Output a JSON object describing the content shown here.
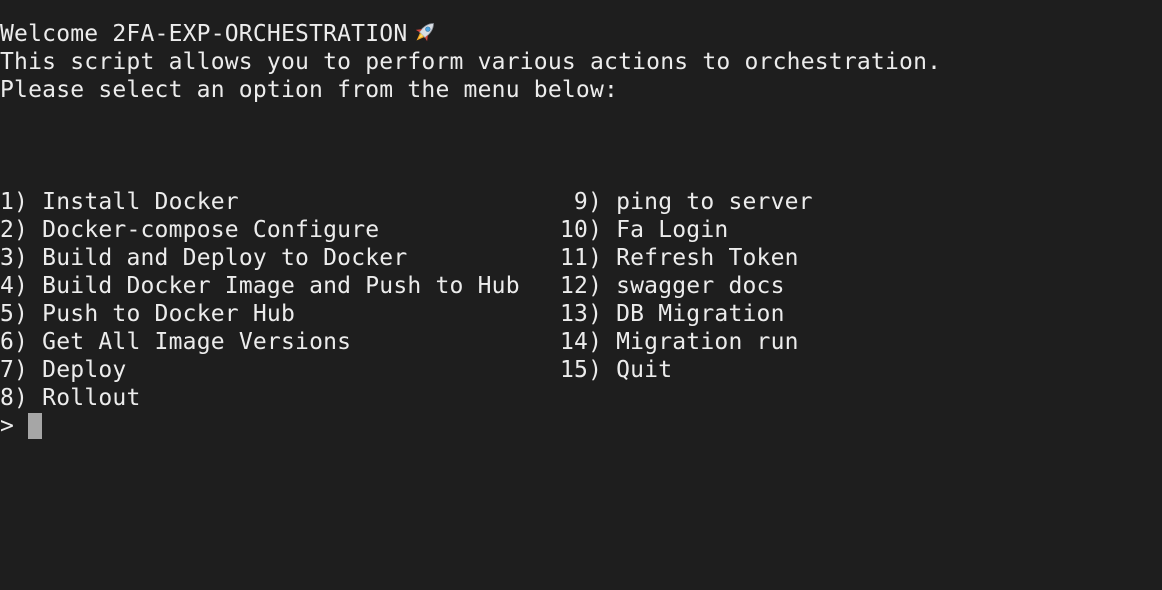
{
  "header": {
    "welcome": "Welcome 2FA-EXP-ORCHESTRATION",
    "welcome_icon": "rocket-icon",
    "description": "This script allows you to perform various actions to orchestration.",
    "instruction": "Please select an option from the menu below:"
  },
  "menu": {
    "left": [
      {
        "num": "1)",
        "label": "Install Docker"
      },
      {
        "num": "2)",
        "label": "Docker-compose Configure"
      },
      {
        "num": "3)",
        "label": "Build and Deploy to Docker"
      },
      {
        "num": "4)",
        "label": "Build Docker Image and Push to Hub"
      },
      {
        "num": "5)",
        "label": "Push to Docker Hub"
      },
      {
        "num": "6)",
        "label": "Get All Image Versions"
      },
      {
        "num": "7)",
        "label": "Deploy"
      },
      {
        "num": "8)",
        "label": "Rollout"
      }
    ],
    "right": [
      {
        "num": "9)",
        "label": "ping to server"
      },
      {
        "num": "10)",
        "label": "Fa Login"
      },
      {
        "num": "11)",
        "label": "Refresh Token"
      },
      {
        "num": "12)",
        "label": "swagger docs"
      },
      {
        "num": "13)",
        "label": "DB Migration"
      },
      {
        "num": "14)",
        "label": "Migration run"
      },
      {
        "num": "15)",
        "label": "Quit"
      }
    ]
  },
  "prompt": {
    "symbol": ">",
    "input_value": ""
  },
  "colors": {
    "background": "#1e1e1e",
    "text": "#ececec",
    "cursor": "#a6a6a6"
  }
}
